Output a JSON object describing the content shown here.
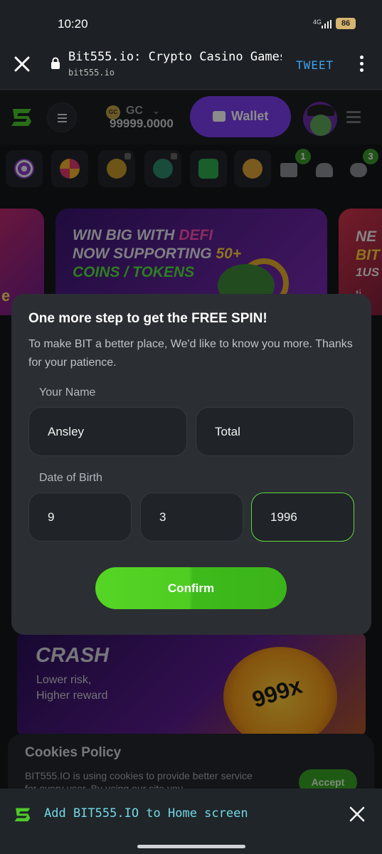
{
  "status_bar": {
    "time": "10:20",
    "network": "4G",
    "battery": "86"
  },
  "browser": {
    "page_title": "Bit555.io: Crypto Casino Games ...",
    "url": "bit555.io",
    "tweet_label": "TWEET",
    "close_icon": "close-icon",
    "lock_icon": "lock-icon",
    "menu_icon": "more-vert-icon"
  },
  "site_header": {
    "currency_code": "GC",
    "coin_symbol": "GC",
    "balance": "99999.0000",
    "wallet_label": "Wallet"
  },
  "icon_row": {
    "badges": {
      "messages": "1",
      "chat": "3"
    }
  },
  "banners": {
    "main_line1_a": "WIN BIG WITH ",
    "main_line1_b": "DEFI",
    "main_line2_a": "NOW SUPPORTING ",
    "main_line2_b": "50+",
    "main_line3": "COINS / TOKENS",
    "right_partial_1": "NE",
    "right_partial_2": "BIT",
    "right_partial_3": "1US",
    "left_partial": "e",
    "right_partial_4": "ti"
  },
  "crash": {
    "title": "CRASH",
    "subtitle_line1": "Lower risk,",
    "subtitle_line2": "Higher reward",
    "multiplier": "999x"
  },
  "cookies": {
    "title": "Cookies Policy",
    "text": "BIT555.IO is using cookies to provide better service for every user. By using our site you",
    "accept_label": "Accept"
  },
  "modal": {
    "title": "One more step to get the FREE SPIN!",
    "description": "To make BIT a better place, We'd like to know you more. Thanks for your patience.",
    "name_label": "Your Name",
    "first_name": "Ansley",
    "last_name": "Total",
    "dob_label": "Date of Birth",
    "dob_month": "9",
    "dob_day": "3",
    "dob_year": "1996",
    "confirm_label": "Confirm"
  },
  "add_to_home": {
    "text": "Add BIT555.IO to Home screen"
  },
  "colors": {
    "accent_green": "#4fcd22",
    "wallet_purple": "#7b3ff0",
    "tweet_blue": "#3ba4f0",
    "a2hs_cyan": "#74d8e9"
  }
}
